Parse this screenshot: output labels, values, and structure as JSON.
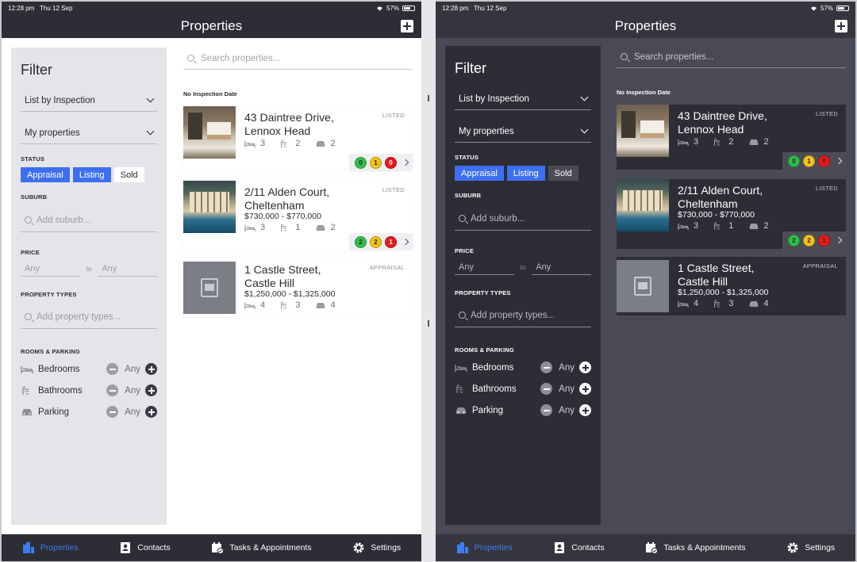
{
  "status_bar": {
    "time": "12:28 pm",
    "date": "Thu 12 Sep",
    "battery": "57%"
  },
  "header": {
    "title": "Properties"
  },
  "filter": {
    "title": "Filter",
    "list_by": "List by Inspection",
    "ownership": "My properties",
    "status_label": "STATUS",
    "status_options": [
      {
        "label": "Appraisal",
        "selected": true
      },
      {
        "label": "Listing",
        "selected": true
      },
      {
        "label": "Sold",
        "selected": false
      }
    ],
    "suburb_label": "SUBURB",
    "suburb_placeholder": "Add suburb...",
    "price_label": "PRICE",
    "price_min_placeholder": "Any",
    "price_to": "to",
    "price_max_placeholder": "Any",
    "property_types_label": "PROPERTY TYPES",
    "property_types_placeholder": "Add property types...",
    "rooms_label": "ROOMS & PARKING",
    "rooms": [
      {
        "label": "Bedrooms",
        "value": "Any"
      },
      {
        "label": "Bathrooms",
        "value": "Any"
      },
      {
        "label": "Parking",
        "value": "Any"
      }
    ]
  },
  "search": {
    "placeholder": "Search properties..."
  },
  "group_label": "No Inspection Date",
  "properties": [
    {
      "address_line1": "43 Daintree Drive,",
      "address_line2": "Lennox Head",
      "price": "",
      "status": "LISTED",
      "beds": "3",
      "baths": "2",
      "cars": "2",
      "lights": [
        "0",
        "1",
        "0"
      ]
    },
    {
      "address_line1": "2/11 Alden Court,",
      "address_line2": "Cheltenham",
      "price": "$730,000 - $770,000",
      "status": "LISTED",
      "beds": "3",
      "baths": "1",
      "cars": "2",
      "lights": [
        "2",
        "2",
        "1"
      ]
    },
    {
      "address_line1": "1 Castle Street,",
      "address_line2": "Castle Hill",
      "price": "$1,250,000 - $1,325,000",
      "status": "APPRAISAL",
      "beds": "4",
      "baths": "3",
      "cars": "4"
    }
  ],
  "tabs": [
    {
      "label": "Properties",
      "icon": "buildings-icon",
      "active": true
    },
    {
      "label": "Contacts",
      "icon": "contact-card-icon",
      "active": false
    },
    {
      "label": "Tasks & Appointments",
      "icon": "calendar-check-icon",
      "active": false
    },
    {
      "label": "Settings",
      "icon": "gear-icon",
      "active": false
    }
  ],
  "colors": {
    "accent": "#3e6ff0",
    "green": "#2fc04a",
    "yellow": "#f7c21a",
    "red": "#e51b1b"
  }
}
